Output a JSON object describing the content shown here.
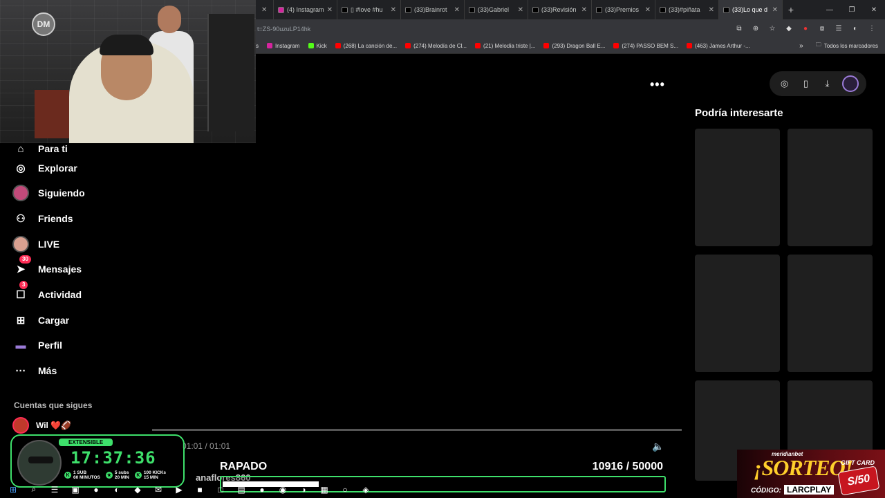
{
  "browser": {
    "tabs": [
      {
        "title": "",
        "color": "#888888",
        "active": false
      },
      {
        "title": "(4) Instagram",
        "color": "#d6249f",
        "active": false
      },
      {
        "title": "▯ #love #hu",
        "color": "#000000",
        "active": false
      },
      {
        "title": "(33)Brainrot",
        "color": "#000000",
        "active": false
      },
      {
        "title": "(33)Gabriel",
        "color": "#000000",
        "active": false
      },
      {
        "title": "(33)Revisión",
        "color": "#000000",
        "active": false
      },
      {
        "title": "(33)Premios",
        "color": "#000000",
        "active": false
      },
      {
        "title": "(33)#piñata",
        "color": "#000000",
        "active": false
      },
      {
        "title": "(33)Lo que d",
        "color": "#000000",
        "active": true
      }
    ],
    "new_tab": "+",
    "window_controls": [
      "—",
      "❐",
      "✕"
    ],
    "url": "t=ZS-90uzuLP14hk",
    "bookmarks": [
      {
        "label": "s",
        "color": "#444444"
      },
      {
        "label": "Instagram",
        "color": "#d6249f"
      },
      {
        "label": "Kick",
        "color": "#53fc18"
      },
      {
        "label": "(268) La canción de...",
        "color": "#ff0000"
      },
      {
        "label": "(274) Melodía de Cl...",
        "color": "#ff0000"
      },
      {
        "label": "(21) Melodía triste |...",
        "color": "#ff0000"
      },
      {
        "label": "(293) Dragon Ball E...",
        "color": "#ff0000"
      },
      {
        "label": "(274) PASSO BEM S...",
        "color": "#ff0000"
      },
      {
        "label": "(463) James Arthur -...",
        "color": "#ff0000"
      }
    ],
    "bookmarks_more": "»",
    "all_bookmarks": "Todos los marcadores"
  },
  "webcam": {
    "logo_text": "DM"
  },
  "sidebar": {
    "items": [
      {
        "label": "Para ti",
        "icon": "home-icon",
        "glyph": "⌂"
      },
      {
        "label": "Explorar",
        "icon": "compass-icon",
        "glyph": "◎"
      },
      {
        "label": "Siguiendo",
        "icon": "avatar",
        "glyph": ""
      },
      {
        "label": "Friends",
        "icon": "friends-icon",
        "glyph": "⚇"
      },
      {
        "label": "LIVE",
        "icon": "avatar",
        "glyph": ""
      },
      {
        "label": "Mensajes",
        "icon": "paper-plane-icon",
        "glyph": "➤",
        "badge": "30"
      },
      {
        "label": "Actividad",
        "icon": "message-icon",
        "glyph": "☐",
        "badge": "3"
      },
      {
        "label": "Cargar",
        "icon": "upload-icon",
        "glyph": "⊞"
      },
      {
        "label": "Perfil",
        "icon": "profile-icon",
        "glyph": "▬"
      },
      {
        "label": "Más",
        "icon": "more-icon",
        "glyph": "···"
      }
    ],
    "following_title": "Cuentas que sigues",
    "following": [
      {
        "name": "Wil ❤️🏈"
      }
    ]
  },
  "video": {
    "more": "•••",
    "time": "01:01 / 01:01",
    "volume_icon": "🔈"
  },
  "right_panel": {
    "title": "Podría interesarte",
    "action_glyphs": [
      "◎",
      "▯",
      "⤓"
    ]
  },
  "overlay": {
    "extensible_label": "EXTENSIBLE",
    "clock": "17:37:36",
    "rates": [
      {
        "icon": "K",
        "line1": "1 SUB",
        "line2": "60 MINUTOS"
      },
      {
        "icon": "★",
        "line1": "5 subs",
        "line2": "20 MIN"
      },
      {
        "icon": "K",
        "line1": "100 KICKs",
        "line2": "15 MIN"
      }
    ],
    "goal_name": "RAPADO",
    "goal_current": 10916,
    "goal_target": 50000,
    "goal_text": "10916  / 50000",
    "chat_ghost": "anaflores860",
    "promo": {
      "brand": "meridianbet",
      "headline": "¡SORTEO!",
      "code_label": "CÓDIGO:",
      "code": "LARCPLAY",
      "gift_label": "GIFT CARD",
      "gift_value": "S/50"
    }
  },
  "taskbar": {
    "icons": [
      "windows-icon",
      "search-icon",
      "task-view-icon",
      "store-icon",
      "chrome-icon",
      "edge-icon",
      "app-icon",
      "mail-icon",
      "app-icon-2",
      "app-icon-3",
      "app-icon-4",
      "folder-icon",
      "chrome-icon-2",
      "obs-icon",
      "app-icon-5",
      "calculator-icon",
      "whatsapp-icon",
      "app-icon-6"
    ],
    "glyphs": [
      "⊞",
      "⌕",
      "☰",
      "▣",
      "●",
      "◐",
      "◆",
      "✉",
      "▶",
      "■",
      "□",
      "▤",
      "●",
      "◉",
      "◑",
      "▦",
      "○",
      "◈"
    ]
  }
}
